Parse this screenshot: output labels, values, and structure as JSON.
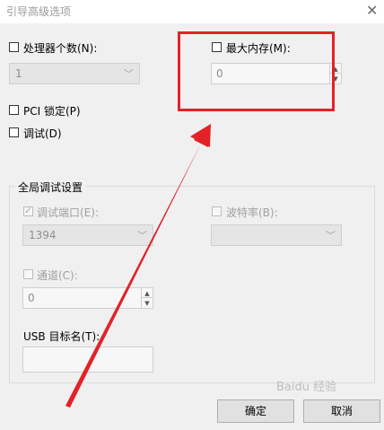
{
  "window": {
    "title": "引导高级选项",
    "close_glyph": "✕"
  },
  "options": {
    "num_processors_label": "处理器个数(N):",
    "num_processors_value": "1",
    "max_memory_label": "最大内存(M):",
    "max_memory_value": "0",
    "pci_lock_label": "PCI 锁定(P)",
    "debug_label": "调试(D)"
  },
  "global_debug": {
    "title": "全局调试设置",
    "debug_port_label": "调试端口(E):",
    "debug_port_value": "1394",
    "baud_rate_label": "波特率(B):",
    "baud_rate_value": "",
    "channel_label": "通道(C):",
    "channel_value": "0",
    "usb_target_label": "USB 目标名(T):",
    "usb_target_value": ""
  },
  "buttons": {
    "ok": "确定",
    "cancel": "取消"
  },
  "watermark": "Baidu 经验",
  "colors": {
    "highlight": "#e32227",
    "arrow": "#e32227",
    "background": "#f0f0f0"
  }
}
